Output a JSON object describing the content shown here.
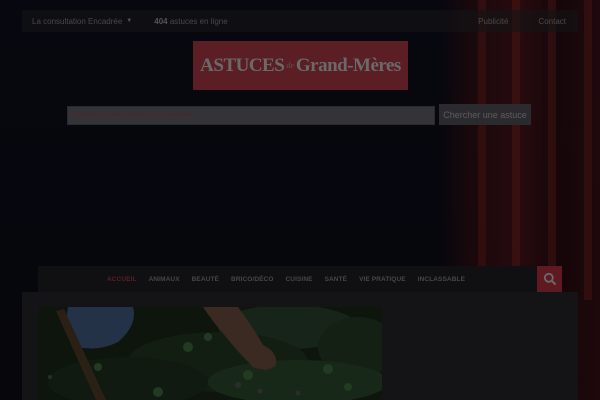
{
  "topbar": {
    "consult_label": "La consultation Encadrée",
    "online_count": "404",
    "online_suffix": "astuces en ligne",
    "links": [
      "Publicité",
      "Contact"
    ]
  },
  "logo": {
    "part1": "ASTUCES",
    "part2": "de",
    "part3": "Grand-Mères"
  },
  "search": {
    "placeholder": "Rechercher dans plus de 1000 astuces de grand-mère",
    "button_label": "Chercher une astuce"
  },
  "nav": {
    "items": [
      {
        "label": "ACCUEIL",
        "active": true
      },
      {
        "label": "ANIMAUX",
        "active": false
      },
      {
        "label": "BEAUTÉ",
        "active": false
      },
      {
        "label": "BRICO/DÉCO",
        "active": false
      },
      {
        "label": "CUISINE",
        "active": false
      },
      {
        "label": "SANTÉ",
        "active": false
      },
      {
        "label": "VIE PRATIQUE",
        "active": false
      },
      {
        "label": "INCLASSABLE",
        "active": false
      }
    ]
  },
  "colors": {
    "accent": "#5e1a20",
    "background": "#06060c"
  },
  "icons": {
    "search": "search-icon",
    "caret": "caret-down-icon"
  }
}
